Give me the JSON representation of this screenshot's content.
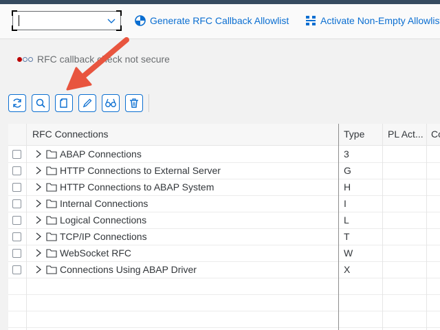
{
  "toolbar": {
    "command_field_value": "",
    "generate_button_label": "Generate RFC Callback Allowlist",
    "activate_button_label": "Activate Non-Empty Allowlist"
  },
  "status": {
    "text": "RFC callback check not secure"
  },
  "icon_bar": {
    "buttons": [
      "refresh-icon",
      "search-icon",
      "create-icon",
      "edit-icon",
      "display-icon",
      "delete-icon"
    ]
  },
  "grid": {
    "headers": {
      "name": "RFC Connections",
      "type": "Type",
      "pl_act": "PL Act...",
      "extra": "Co"
    },
    "rows": [
      {
        "name": "ABAP Connections",
        "type": "3"
      },
      {
        "name": "HTTP Connections to External Server",
        "type": "G"
      },
      {
        "name": "HTTP Connections to ABAP System",
        "type": "H"
      },
      {
        "name": "Internal Connections",
        "type": "I"
      },
      {
        "name": "Logical Connections",
        "type": "L"
      },
      {
        "name": "TCP/IP Connections",
        "type": "T"
      },
      {
        "name": "WebSocket RFC",
        "type": "W"
      },
      {
        "name": "Connections Using ABAP Driver",
        "type": "X"
      }
    ]
  },
  "colors": {
    "accent": "#0a6ed1",
    "shell": "#354a5f",
    "arrow": "#e8553f",
    "status_red": "#bb0000"
  }
}
